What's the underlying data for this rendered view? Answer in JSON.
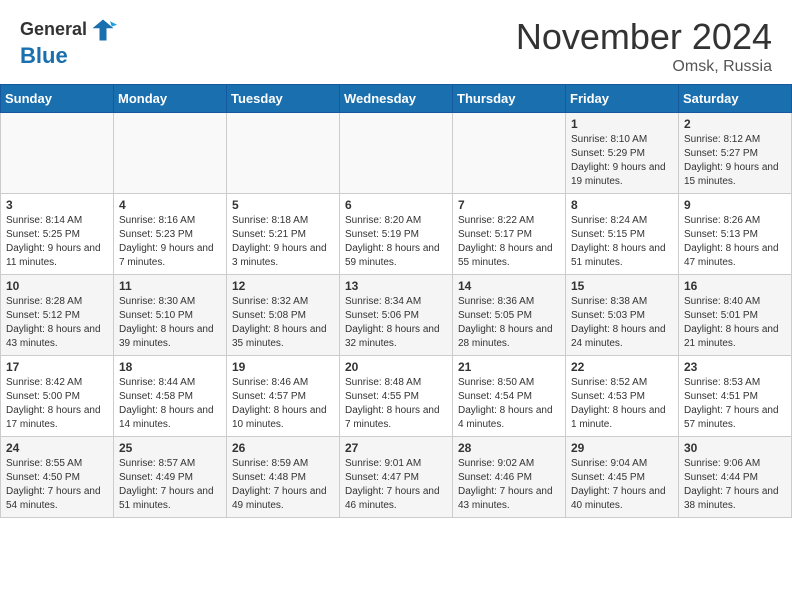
{
  "header": {
    "logo_line1": "General",
    "logo_line2": "Blue",
    "month_year": "November 2024",
    "location": "Omsk, Russia"
  },
  "days_of_week": [
    "Sunday",
    "Monday",
    "Tuesday",
    "Wednesday",
    "Thursday",
    "Friday",
    "Saturday"
  ],
  "weeks": [
    [
      {
        "day": "",
        "info": ""
      },
      {
        "day": "",
        "info": ""
      },
      {
        "day": "",
        "info": ""
      },
      {
        "day": "",
        "info": ""
      },
      {
        "day": "",
        "info": ""
      },
      {
        "day": "1",
        "info": "Sunrise: 8:10 AM\nSunset: 5:29 PM\nDaylight: 9 hours\nand 19 minutes."
      },
      {
        "day": "2",
        "info": "Sunrise: 8:12 AM\nSunset: 5:27 PM\nDaylight: 9 hours\nand 15 minutes."
      }
    ],
    [
      {
        "day": "3",
        "info": "Sunrise: 8:14 AM\nSunset: 5:25 PM\nDaylight: 9 hours\nand 11 minutes."
      },
      {
        "day": "4",
        "info": "Sunrise: 8:16 AM\nSunset: 5:23 PM\nDaylight: 9 hours\nand 7 minutes."
      },
      {
        "day": "5",
        "info": "Sunrise: 8:18 AM\nSunset: 5:21 PM\nDaylight: 9 hours\nand 3 minutes."
      },
      {
        "day": "6",
        "info": "Sunrise: 8:20 AM\nSunset: 5:19 PM\nDaylight: 8 hours\nand 59 minutes."
      },
      {
        "day": "7",
        "info": "Sunrise: 8:22 AM\nSunset: 5:17 PM\nDaylight: 8 hours\nand 55 minutes."
      },
      {
        "day": "8",
        "info": "Sunrise: 8:24 AM\nSunset: 5:15 PM\nDaylight: 8 hours\nand 51 minutes."
      },
      {
        "day": "9",
        "info": "Sunrise: 8:26 AM\nSunset: 5:13 PM\nDaylight: 8 hours\nand 47 minutes."
      }
    ],
    [
      {
        "day": "10",
        "info": "Sunrise: 8:28 AM\nSunset: 5:12 PM\nDaylight: 8 hours\nand 43 minutes."
      },
      {
        "day": "11",
        "info": "Sunrise: 8:30 AM\nSunset: 5:10 PM\nDaylight: 8 hours\nand 39 minutes."
      },
      {
        "day": "12",
        "info": "Sunrise: 8:32 AM\nSunset: 5:08 PM\nDaylight: 8 hours\nand 35 minutes."
      },
      {
        "day": "13",
        "info": "Sunrise: 8:34 AM\nSunset: 5:06 PM\nDaylight: 8 hours\nand 32 minutes."
      },
      {
        "day": "14",
        "info": "Sunrise: 8:36 AM\nSunset: 5:05 PM\nDaylight: 8 hours\nand 28 minutes."
      },
      {
        "day": "15",
        "info": "Sunrise: 8:38 AM\nSunset: 5:03 PM\nDaylight: 8 hours\nand 24 minutes."
      },
      {
        "day": "16",
        "info": "Sunrise: 8:40 AM\nSunset: 5:01 PM\nDaylight: 8 hours\nand 21 minutes."
      }
    ],
    [
      {
        "day": "17",
        "info": "Sunrise: 8:42 AM\nSunset: 5:00 PM\nDaylight: 8 hours\nand 17 minutes."
      },
      {
        "day": "18",
        "info": "Sunrise: 8:44 AM\nSunset: 4:58 PM\nDaylight: 8 hours\nand 14 minutes."
      },
      {
        "day": "19",
        "info": "Sunrise: 8:46 AM\nSunset: 4:57 PM\nDaylight: 8 hours\nand 10 minutes."
      },
      {
        "day": "20",
        "info": "Sunrise: 8:48 AM\nSunset: 4:55 PM\nDaylight: 8 hours\nand 7 minutes."
      },
      {
        "day": "21",
        "info": "Sunrise: 8:50 AM\nSunset: 4:54 PM\nDaylight: 8 hours\nand 4 minutes."
      },
      {
        "day": "22",
        "info": "Sunrise: 8:52 AM\nSunset: 4:53 PM\nDaylight: 8 hours\nand 1 minute."
      },
      {
        "day": "23",
        "info": "Sunrise: 8:53 AM\nSunset: 4:51 PM\nDaylight: 7 hours\nand 57 minutes."
      }
    ],
    [
      {
        "day": "24",
        "info": "Sunrise: 8:55 AM\nSunset: 4:50 PM\nDaylight: 7 hours\nand 54 minutes."
      },
      {
        "day": "25",
        "info": "Sunrise: 8:57 AM\nSunset: 4:49 PM\nDaylight: 7 hours\nand 51 minutes."
      },
      {
        "day": "26",
        "info": "Sunrise: 8:59 AM\nSunset: 4:48 PM\nDaylight: 7 hours\nand 49 minutes."
      },
      {
        "day": "27",
        "info": "Sunrise: 9:01 AM\nSunset: 4:47 PM\nDaylight: 7 hours\nand 46 minutes."
      },
      {
        "day": "28",
        "info": "Sunrise: 9:02 AM\nSunset: 4:46 PM\nDaylight: 7 hours\nand 43 minutes."
      },
      {
        "day": "29",
        "info": "Sunrise: 9:04 AM\nSunset: 4:45 PM\nDaylight: 7 hours\nand 40 minutes."
      },
      {
        "day": "30",
        "info": "Sunrise: 9:06 AM\nSunset: 4:44 PM\nDaylight: 7 hours\nand 38 minutes."
      }
    ]
  ]
}
